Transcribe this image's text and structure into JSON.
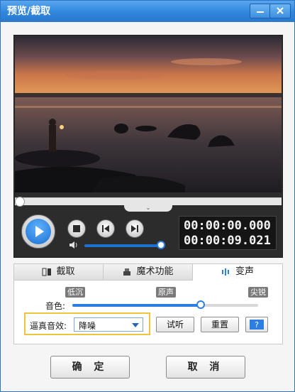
{
  "window": {
    "title": "预览/截取",
    "minimize_icon": "minimize-icon",
    "close_icon": "close-icon",
    "accent": "#2f86dc"
  },
  "player": {
    "current_time": "00:00:00.000",
    "total_time": "00:00:09.021",
    "seek_position": 0.0,
    "volume": 1.0,
    "icons": [
      "play-icon",
      "stop-icon",
      "prev-frame-icon",
      "next-frame-icon",
      "volume-icon",
      "collapse-chevron-icon"
    ]
  },
  "tabs": [
    {
      "label": "截取",
      "icon": "clip-icon",
      "active": false
    },
    {
      "label": "魔术功能",
      "icon": "magic-icon",
      "active": false
    },
    {
      "label": "变声",
      "icon": "voice-wave-icon",
      "active": true
    }
  ],
  "voice": {
    "low_label": "低沉",
    "original_label": "原声",
    "high_label": "尖锐",
    "tone_label": "音色:",
    "tone_value": 0.69,
    "effect_label": "逼真音效:",
    "effect_value": "降噪",
    "try_label": "试听",
    "reset_label": "重置",
    "help_icon": "help-icon"
  },
  "footer": {
    "ok_label": "确 定",
    "cancel_label": "取 消"
  }
}
